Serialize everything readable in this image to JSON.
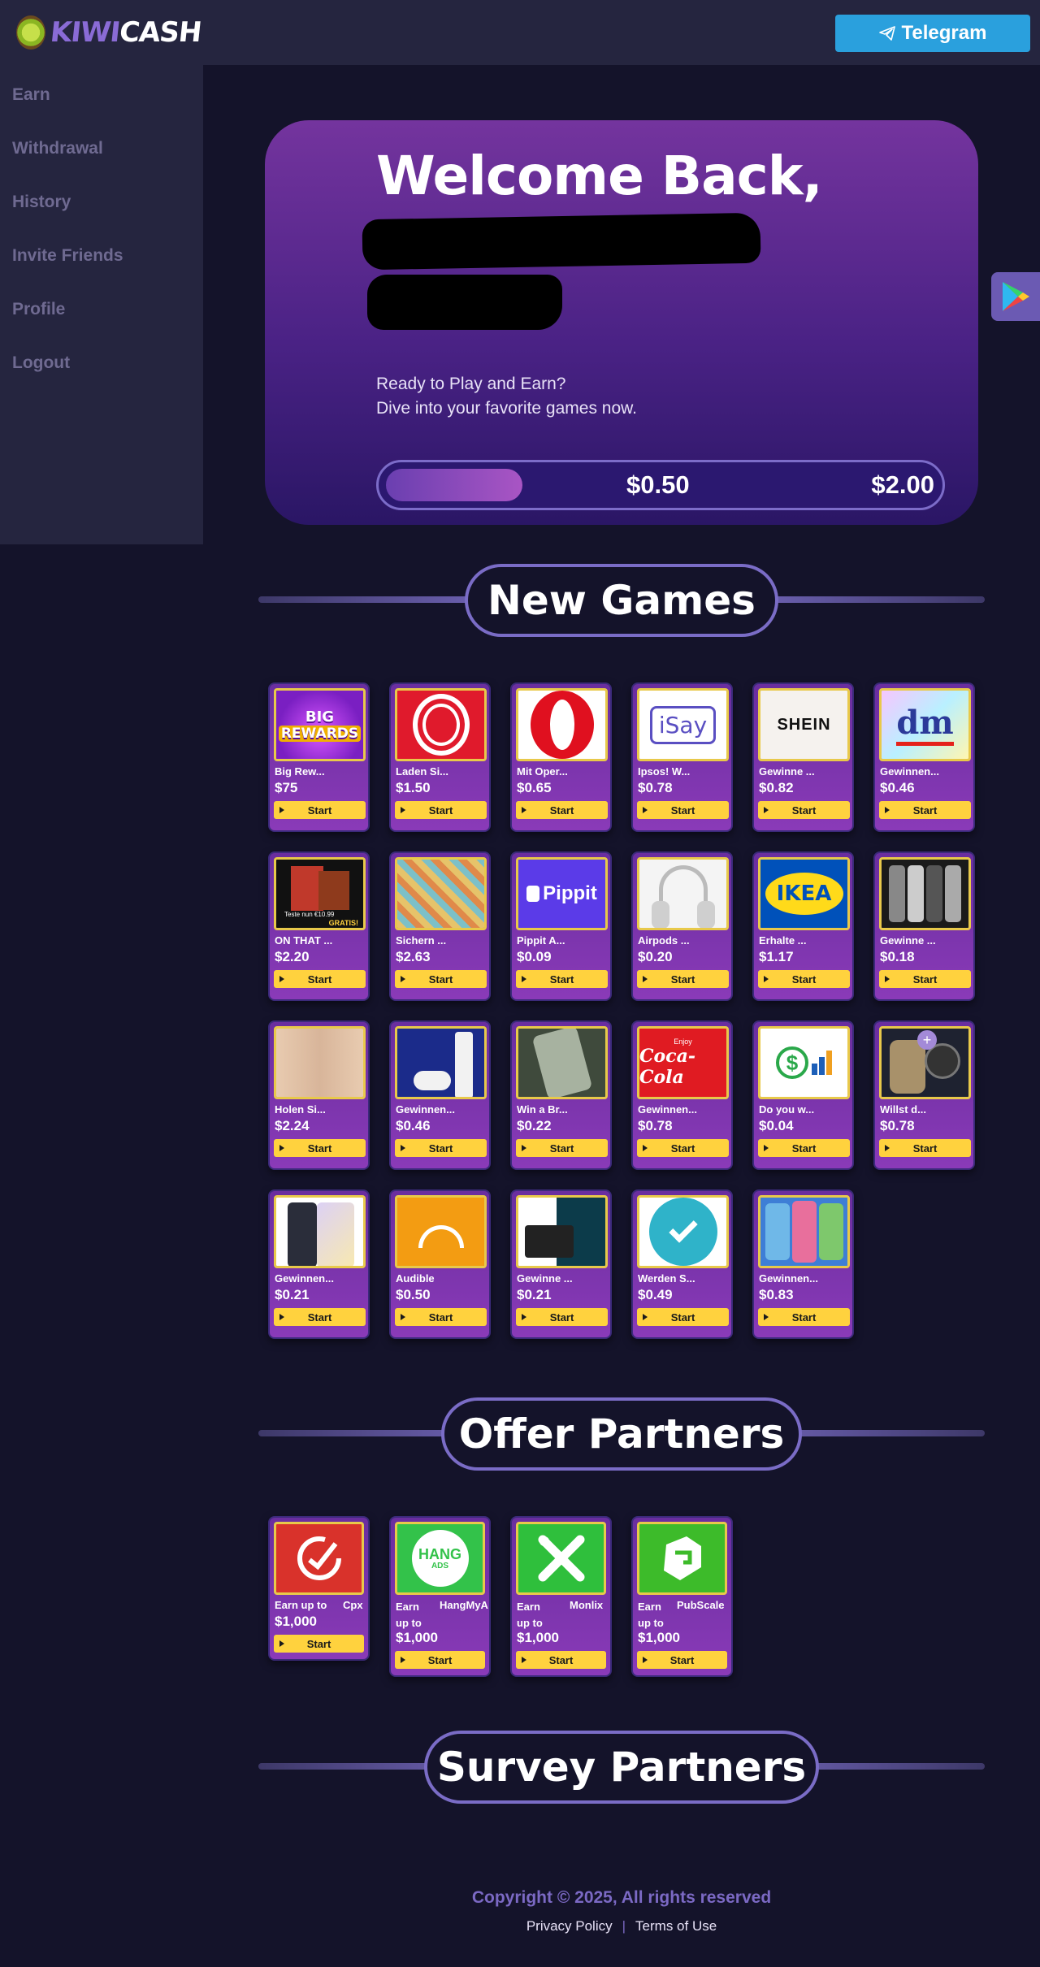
{
  "brand": {
    "logo_text_1": "KIWI",
    "logo_text_2": "CASH",
    "telegram_label": "Telegram"
  },
  "sidebar": {
    "items": [
      {
        "label": "Earn"
      },
      {
        "label": "Withdrawal"
      },
      {
        "label": "History"
      },
      {
        "label": "Invite Friends"
      },
      {
        "label": "Profile"
      },
      {
        "label": "Logout"
      }
    ]
  },
  "welcome": {
    "title": "Welcome Back,",
    "sub_line1": "Ready to Play and Earn?",
    "sub_line2": "Dive into your favorite games now.",
    "progress_current": "$0.50",
    "progress_max": "$2.00",
    "progress_fraction": 0.25
  },
  "sections": {
    "games": "New Games",
    "offers": "Offer Partners",
    "surveys": "Survey Partners"
  },
  "start_label": "Start",
  "games": [
    {
      "title": "Big Rew...",
      "price": "$75",
      "thumb": "big-rewards"
    },
    {
      "title": "Laden Si...",
      "price": "$1.50",
      "thumb": "opera-ring"
    },
    {
      "title": "Mit Oper...",
      "price": "$0.65",
      "thumb": "opera"
    },
    {
      "title": "Ipsos! W...",
      "price": "$0.78",
      "thumb": "isay"
    },
    {
      "title": "Gewinne ...",
      "price": "$0.82",
      "thumb": "shein"
    },
    {
      "title": "Gewinnen...",
      "price": "$0.46",
      "thumb": "dm"
    },
    {
      "title": "ON THAT ...",
      "price": "$2.20",
      "thumb": "underwear-box"
    },
    {
      "title": "Sichern ...",
      "price": "$2.63",
      "thumb": "pattern-shorts"
    },
    {
      "title": "Pippit A...",
      "price": "$0.09",
      "thumb": "pippit"
    },
    {
      "title": "Airpods ...",
      "price": "$0.20",
      "thumb": "airpods-max"
    },
    {
      "title": "Erhalte ...",
      "price": "$1.17",
      "thumb": "ikea"
    },
    {
      "title": "Gewinne ...",
      "price": "$0.18",
      "thumb": "iphones"
    },
    {
      "title": "Holen Si...",
      "price": "$2.24",
      "thumb": "lingerie"
    },
    {
      "title": "Gewinnen...",
      "price": "$0.46",
      "thumb": "ps5"
    },
    {
      "title": "Win a Br...",
      "price": "$0.22",
      "thumb": "samsung-phone"
    },
    {
      "title": "Gewinnen...",
      "price": "$0.78",
      "thumb": "coca-cola"
    },
    {
      "title": "Do you w...",
      "price": "$0.04",
      "thumb": "dollar-chart"
    },
    {
      "title": "Willst d...",
      "price": "$0.78",
      "thumb": "galaxy-watch"
    },
    {
      "title": "Gewinnen...",
      "price": "$0.21",
      "thumb": "galaxy-a"
    },
    {
      "title": "Audible",
      "price": "$0.50",
      "thumb": "audible"
    },
    {
      "title": "Gewinne ...",
      "price": "$0.21",
      "thumb": "console"
    },
    {
      "title": "Werden S...",
      "price": "$0.49",
      "thumb": "checkmark"
    },
    {
      "title": "Gewinnen...",
      "price": "$0.83",
      "thumb": "phones-blue"
    }
  ],
  "offers": [
    {
      "earn": "Earn up to",
      "name": "Cpx",
      "price": "$1,000",
      "thumb": "cpx",
      "color": "#d9322b"
    },
    {
      "earn": "Earn up to",
      "name": "HangMyA",
      "price": "$1,000",
      "thumb": "hang-ads",
      "color": "#33c24a"
    },
    {
      "earn": "Earn up to",
      "name": "Monlix",
      "price": "$1,000",
      "thumb": "monlix",
      "color": "#2fbf3c"
    },
    {
      "earn": "Earn up to",
      "name": "PubScale",
      "price": "$1,000",
      "thumb": "pubscale",
      "color": "#3dbb2a"
    }
  ],
  "thumb_texts": {
    "big_rewards_1": "BIG",
    "big_rewards_2": "REWARDS",
    "isay": "iSay",
    "shein": "SHEIN",
    "dm": "dm",
    "underwear_promo": "Teste nun €10.99",
    "underwear_gratis": "GRATIS!",
    "pippit": "Pippit",
    "ikea": "IKEA",
    "coca_cola_1": "Enjoy",
    "coca_cola_2": "Coca-Cola",
    "hang_1": "HANG",
    "hang_2": "ADS"
  },
  "footer": {
    "copyright": "Copyright © 2025, All rights reserved",
    "privacy": "Privacy Policy",
    "terms": "Terms of Use"
  }
}
